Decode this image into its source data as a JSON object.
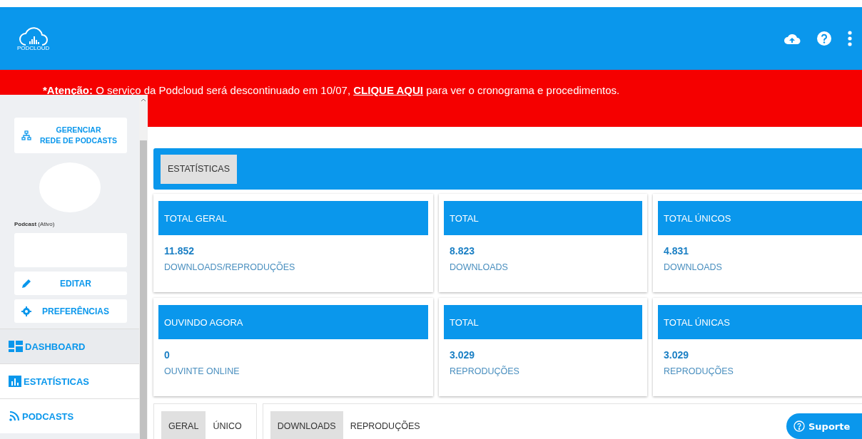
{
  "header": {
    "logo_text": "PODCLOUD"
  },
  "banner": {
    "label": "*Atenção:",
    "text": "O serviço da Podcloud será descontinuado em 10/07,",
    "link": "CLIQUE AQUI",
    "after": "para ver o cronograma e procedimentos."
  },
  "sidebar": {
    "manage_button": [
      "GERENCIAR",
      "REDE DE PODCASTS"
    ],
    "podcast_label": "**Podcast** (Ativo)",
    "buttons": [
      {
        "kind": "edit",
        "label": "EDITAR"
      },
      {
        "kind": "settings",
        "label": "PREFERÊNCIAS"
      }
    ],
    "nav": [
      {
        "kind": "dashboard",
        "label": "DASHBOARD",
        "selected": true
      },
      {
        "kind": "stats",
        "label": "ESTATÍSTICAS",
        "selected": false
      },
      {
        "kind": "rss",
        "label": "PODCASTS",
        "selected": false
      }
    ]
  },
  "tabs": [
    {
      "label": "ESTATÍSTICAS",
      "selected": true
    }
  ],
  "cards": [
    {
      "title": "TOTAL GERAL",
      "value": "11.852",
      "caption": "DOWNLOADS/REPRODUÇÕES"
    },
    {
      "title": "TOTAL",
      "value": "8.823",
      "caption": "DOWNLOADS"
    },
    {
      "title": "TOTAL ÚNICOS",
      "value": "4.831",
      "caption": "DOWNLOADS"
    },
    {
      "title": "OUVINDO AGORA",
      "value": "0",
      "caption": "OUVINTE ONLINE"
    },
    {
      "title": "TOTAL",
      "value": "3.029",
      "caption": "REPRODUÇÕES"
    },
    {
      "title": "TOTAL ÚNICAS",
      "value": "3.029",
      "caption": "REPRODUÇÕES"
    }
  ],
  "toggle_groups": [
    [
      {
        "label": "GERAL",
        "selected": true
      },
      {
        "label": "ÚNICO",
        "selected": false
      }
    ],
    [
      {
        "label": "DOWNLOADS",
        "selected": true
      },
      {
        "label": "REPRODUÇÕES",
        "selected": false
      }
    ]
  ],
  "support_button": "Suporte"
}
